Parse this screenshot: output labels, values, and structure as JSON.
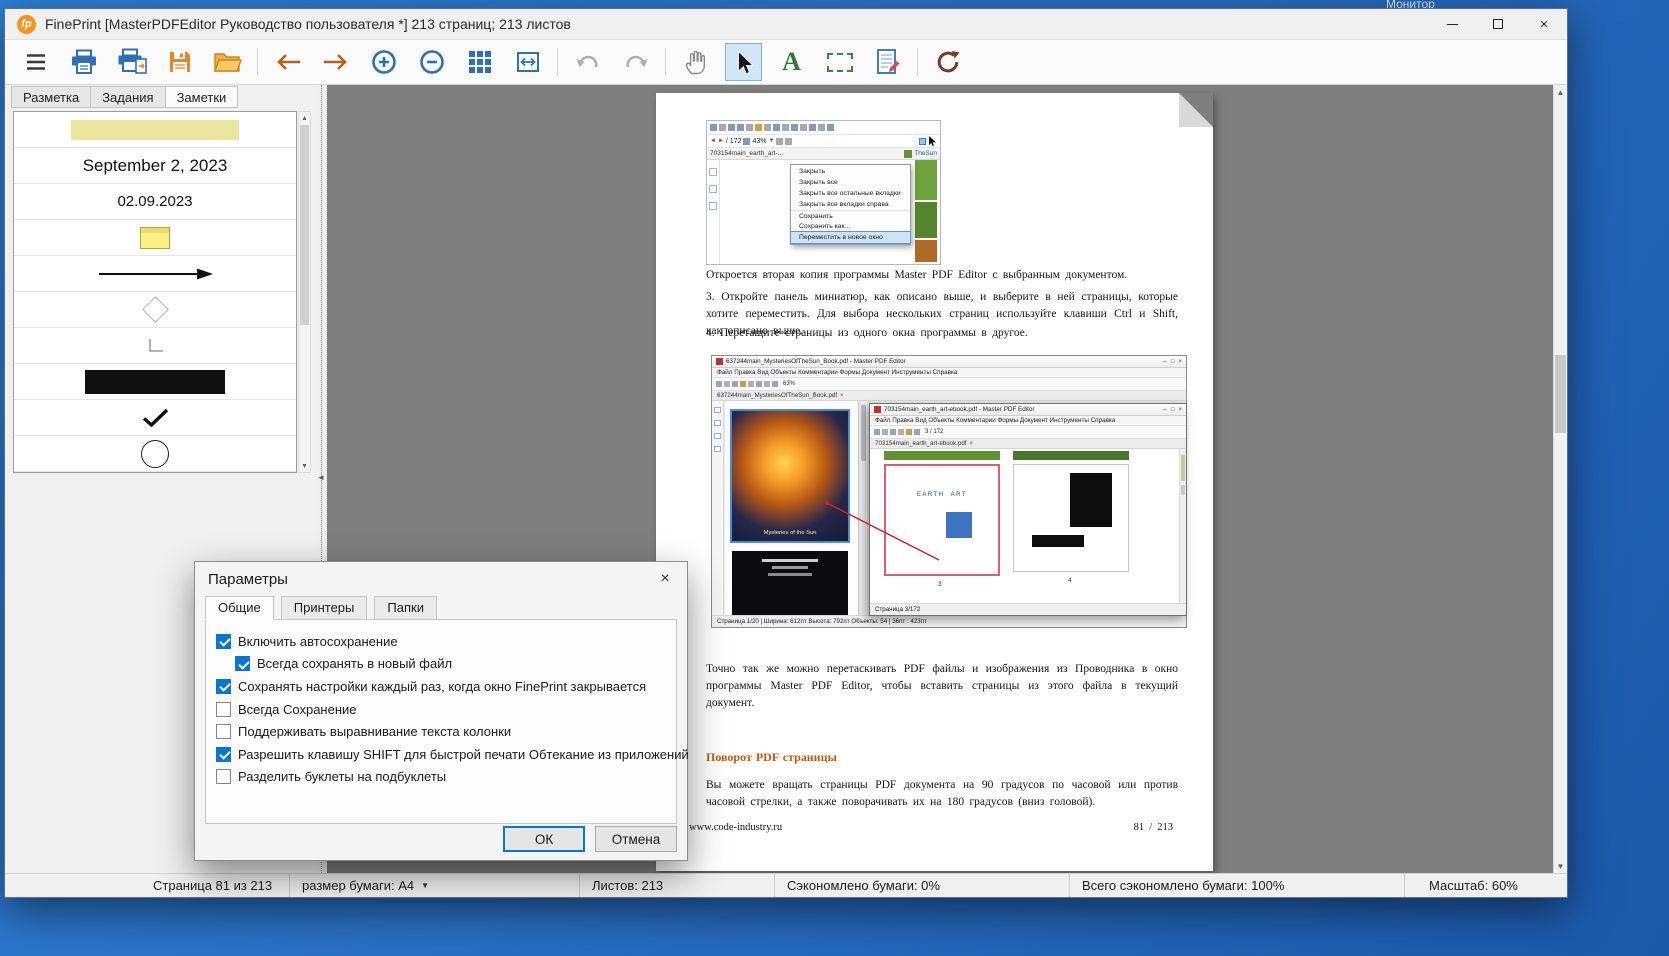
{
  "desktop": {
    "background_text": "Монитор"
  },
  "icons": {
    "minimize": "─",
    "maximize": "□",
    "close": "×",
    "tab_close": "×",
    "dropdown": "▼",
    "arrow_up": "▲",
    "arrow_down": "▼",
    "arrow_left": "◄",
    "arrow_right": "►",
    "collapse_left": "◄"
  },
  "titlebar": {
    "logo": "fp",
    "title": "FinePrint [MasterPDFEditor Руководство пользователя *] 213 страниц; 213 листов"
  },
  "toolbar": {
    "text_tool": "A"
  },
  "left_panel": {
    "tabs": [
      {
        "label": "Разметка",
        "active": false
      },
      {
        "label": "Задания",
        "active": false
      },
      {
        "label": "Заметки",
        "active": true
      }
    ],
    "notes": {
      "date_long": "September 2, 2023",
      "date_short": "02.09.2023"
    }
  },
  "dialog": {
    "title": "Параметры",
    "close": "×",
    "tabs": [
      {
        "label": "Общие",
        "active": true
      },
      {
        "label": "Принтеры",
        "active": false
      },
      {
        "label": "Папки",
        "active": false
      }
    ],
    "options": [
      {
        "label": "Включить автосохранение",
        "checked": true,
        "indent": false
      },
      {
        "label": "Всегда сохранять в новый файл",
        "checked": true,
        "indent": true
      },
      {
        "label": "Сохранять настройки каждый раз, когда окно FinePrint закрывается",
        "checked": true,
        "indent": false
      },
      {
        "label": "Всегда Сохранение",
        "checked": false,
        "indent": false
      },
      {
        "label": "Поддерживать выравнивание текста колонки",
        "checked": false,
        "indent": false
      },
      {
        "label": "Разрешить клавишу SHIFT для быстрой печати Обтекание из приложений",
        "checked": true,
        "indent": false
      },
      {
        "label": "Разделить буклеты на подбуклеты",
        "checked": false,
        "indent": false
      }
    ],
    "ok": "ОК",
    "cancel": "Отмена"
  },
  "document": {
    "para_copy": "Откроется вторая копия программы Master PDF Editor с выбранным документом.",
    "item3": "3.  Откройте панель миниатюр, как описано выше, и выберите в ней страницы, которые хотите переместить. Для выбора нескольких страниц используйте клавиши Ctrl и Shift, как описано выше.",
    "item4": "4.  Перетащите страницы из одного окна программы в другое.",
    "para_drag": "Точно так же можно перетаскивать PDF файлы и изображения из Проводника в окно программы Master PDF Editor, чтобы вставить страницы из этого файла в текущий документ.",
    "heading_rotate": "Поворот PDF страницы",
    "para_rotate": "Вы можете вращать страницы PDF документа на 90 градусов по часовой или против часовой стрелки, а также поворачивать их на 180 градусов (вниз головой).",
    "footer_url": "www.code-industry.ru",
    "footer_page": "81 / 213",
    "shot1": {
      "nav_pages": "/ 172",
      "zoom": "43%",
      "tab1": "703154main_earth_art-...",
      "tab2": "TheSun",
      "menu": [
        {
          "label": "Закрыть",
          "selected": false
        },
        {
          "label": "Закрыть все",
          "selected": false
        },
        {
          "label": "Закрыть все остальные вкладки",
          "selected": false
        },
        {
          "label": "Закрыть все вкладки справа",
          "selected": false
        },
        {
          "label": "Сохранить",
          "selected": false
        },
        {
          "label": "Сохранить как...",
          "selected": false
        },
        {
          "label": "Переместить в новое окно",
          "selected": true
        }
      ]
    },
    "shot2": {
      "win_a": {
        "title": "637244main_MysteriesOfTheSun_Book.pdf - Master PDF Editor",
        "menu": "Файл Правка Вид Объекты Комментарии Формы Документ Инструменты Справка",
        "zoom": "63%",
        "tab": "637244main_MysteriesOfTheSun_Book.pdf",
        "thumb1_caption": "Mysteries of the Sun",
        "status": "Страница 1/20 | Ширина: 612пт Высота: 792пт Объекты: 54 |  36пт : 423пт"
      },
      "win_b": {
        "title": "703154main_earth_art-ebook.pdf - Master PDF Editor",
        "menu": "Файл Правка Вид Объекты Комментарии Формы Документ Инструменты Справка",
        "nav": "3 / 172",
        "tab": "703154main_earth_art-ebook.pdf",
        "page3_line1": "EARTH",
        "page3_line2": "ART",
        "num3": "3",
        "num4": "4",
        "status": "Страница 3/172"
      }
    }
  },
  "status_bar": {
    "page": "Страница 81 из 213",
    "paper": "размер бумаги: A4",
    "sheets": "Листов: 213",
    "saved": "Сэкономлено бумаги: 0%",
    "saved_total": "Всего сэкономлено бумаги: 100%",
    "scale": "Масштаб: 60%"
  }
}
